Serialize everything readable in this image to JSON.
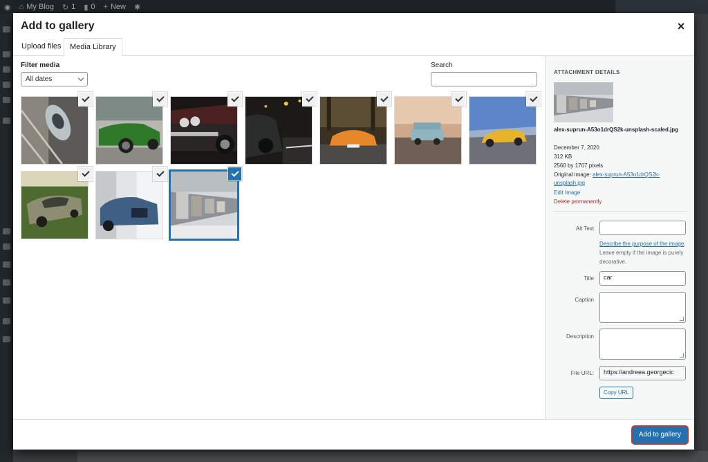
{
  "adminbar": {
    "site_name": "My Blog",
    "updates_count": "1",
    "comments_count": "0",
    "new_label": "New"
  },
  "modal": {
    "title": "Add to gallery",
    "close_glyph": "×"
  },
  "tabs": [
    {
      "label": "Upload files",
      "active": false
    },
    {
      "label": "Media Library",
      "active": true
    }
  ],
  "filter": {
    "label": "Filter media",
    "selected": "All dates"
  },
  "search": {
    "label": "Search",
    "value": ""
  },
  "media_items": [
    {
      "subject": "white car top view",
      "checked": true,
      "active": false
    },
    {
      "subject": "green sports car",
      "checked": true,
      "active": false
    },
    {
      "subject": "classic car front",
      "checked": true,
      "active": false
    },
    {
      "subject": "dark car at night",
      "checked": true,
      "active": false
    },
    {
      "subject": "orange supercar",
      "checked": true,
      "active": false
    },
    {
      "subject": "blue mini",
      "checked": true,
      "active": false
    },
    {
      "subject": "yellow sports car",
      "checked": true,
      "active": false
    },
    {
      "subject": "olive classic coupe",
      "checked": true,
      "active": false
    },
    {
      "subject": "blue luxury sedan",
      "checked": true,
      "active": false
    },
    {
      "subject": "row of vintage cars",
      "checked": true,
      "active": true
    }
  ],
  "details": {
    "heading": "Attachment Details",
    "filename": "alex-suprun-A53o1drQS2k-unsplash-scaled.jpg",
    "date": "December 7, 2020",
    "size": "312 KB",
    "dimensions": "2560 by 1707 pixels",
    "original_label": "Original image:",
    "original_link": "alex-suprun-A53o1drQS2k-unsplash.jpg",
    "edit_link": "Edit Image",
    "delete_link": "Delete permanently",
    "alt_label": "Alt Text",
    "alt_value": "",
    "alt_help_link": "Describe the purpose of the image",
    "alt_help_text": ". Leave empty if the image is purely decorative.",
    "title_label": "Title",
    "title_value": "car",
    "caption_label": "Caption",
    "caption_value": "",
    "description_label": "Description",
    "description_value": "",
    "url_label": "File URL:",
    "url_value": "https://andreea.georgecic",
    "copy_button": "Copy URL"
  },
  "toolbar": {
    "primary_button": "Add to gallery"
  },
  "colors": {
    "accent": "#2271b1",
    "delete": "#b32d2e",
    "admin_bar": "#1d2327"
  }
}
